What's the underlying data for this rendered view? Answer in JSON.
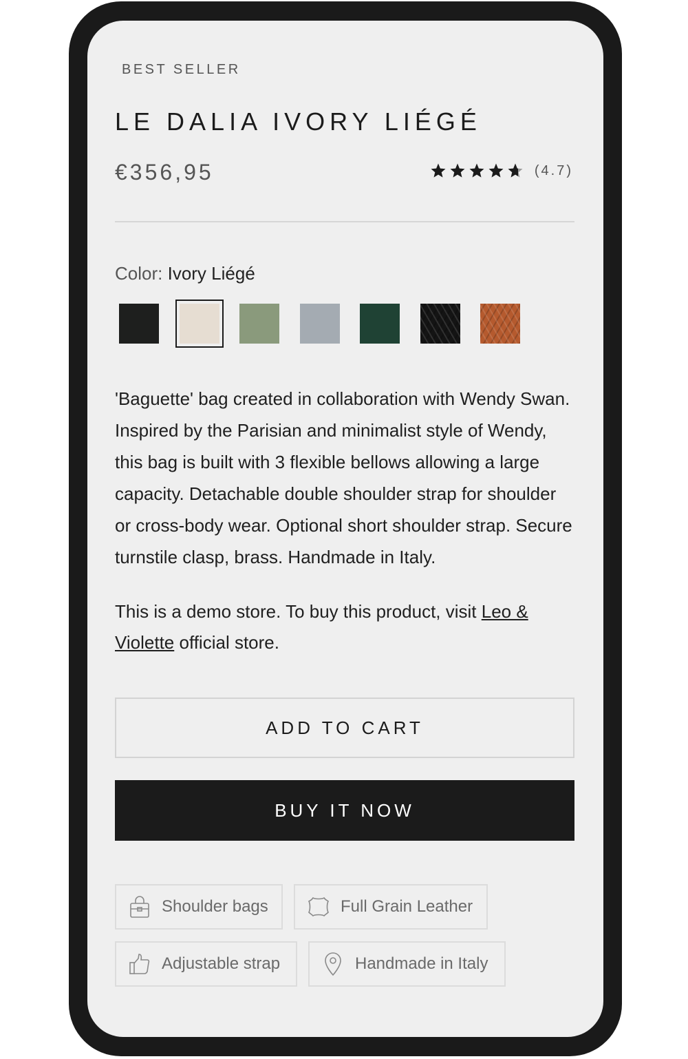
{
  "product": {
    "eyebrow": "BEST SELLER",
    "title": "LE DALIA IVORY LIÉGÉ",
    "price": "€356,95",
    "rating": {
      "value": 4.7,
      "max": 5,
      "label": "(4.7)"
    }
  },
  "color": {
    "label": "Color:",
    "selected": "Ivory Liégé",
    "swatches": [
      {
        "name": "black",
        "color": "#1e1f1e",
        "selected": false
      },
      {
        "name": "ivory",
        "color": "#e6ddd2",
        "selected": true
      },
      {
        "name": "sage",
        "color": "#8a9a7c",
        "selected": false
      },
      {
        "name": "grey",
        "color": "#a4abb2",
        "selected": false
      },
      {
        "name": "dark-green",
        "color": "#1f4234",
        "selected": false
      },
      {
        "name": "black-lizard",
        "color": "#141414",
        "selected": false
      },
      {
        "name": "cognac-lizard",
        "color": "#b55a2e",
        "selected": false
      }
    ]
  },
  "description": "'Baguette' bag created in collaboration with Wendy Swan. Inspired by the Parisian and minimalist style of Wendy, this bag is built with 3 flexible bellows allowing a large capacity. Detachable double shoulder strap for shoulder or cross-body wear. Optional short shoulder strap. Secure turnstile clasp, brass. Handmade in Italy.",
  "demo_notice": {
    "before": "This is a demo store. To buy this product, visit ",
    "link": "Leo & Violette",
    "after": " official store."
  },
  "buttons": {
    "add_to_cart": "ADD TO CART",
    "buy_now": "BUY IT NOW"
  },
  "tags": [
    {
      "label": "Shoulder bags",
      "icon": "shopping-bag-icon"
    },
    {
      "label": "Full Grain Leather",
      "icon": "leather-hide-icon"
    },
    {
      "label": "Adjustable strap",
      "icon": "thumbs-up-icon"
    },
    {
      "label": "Handmade in Italy",
      "icon": "location-pin-icon"
    }
  ],
  "colors": {
    "screen_bg": "#efefef",
    "frame": "#1a1a1a",
    "primary": "#1b1b1b"
  }
}
